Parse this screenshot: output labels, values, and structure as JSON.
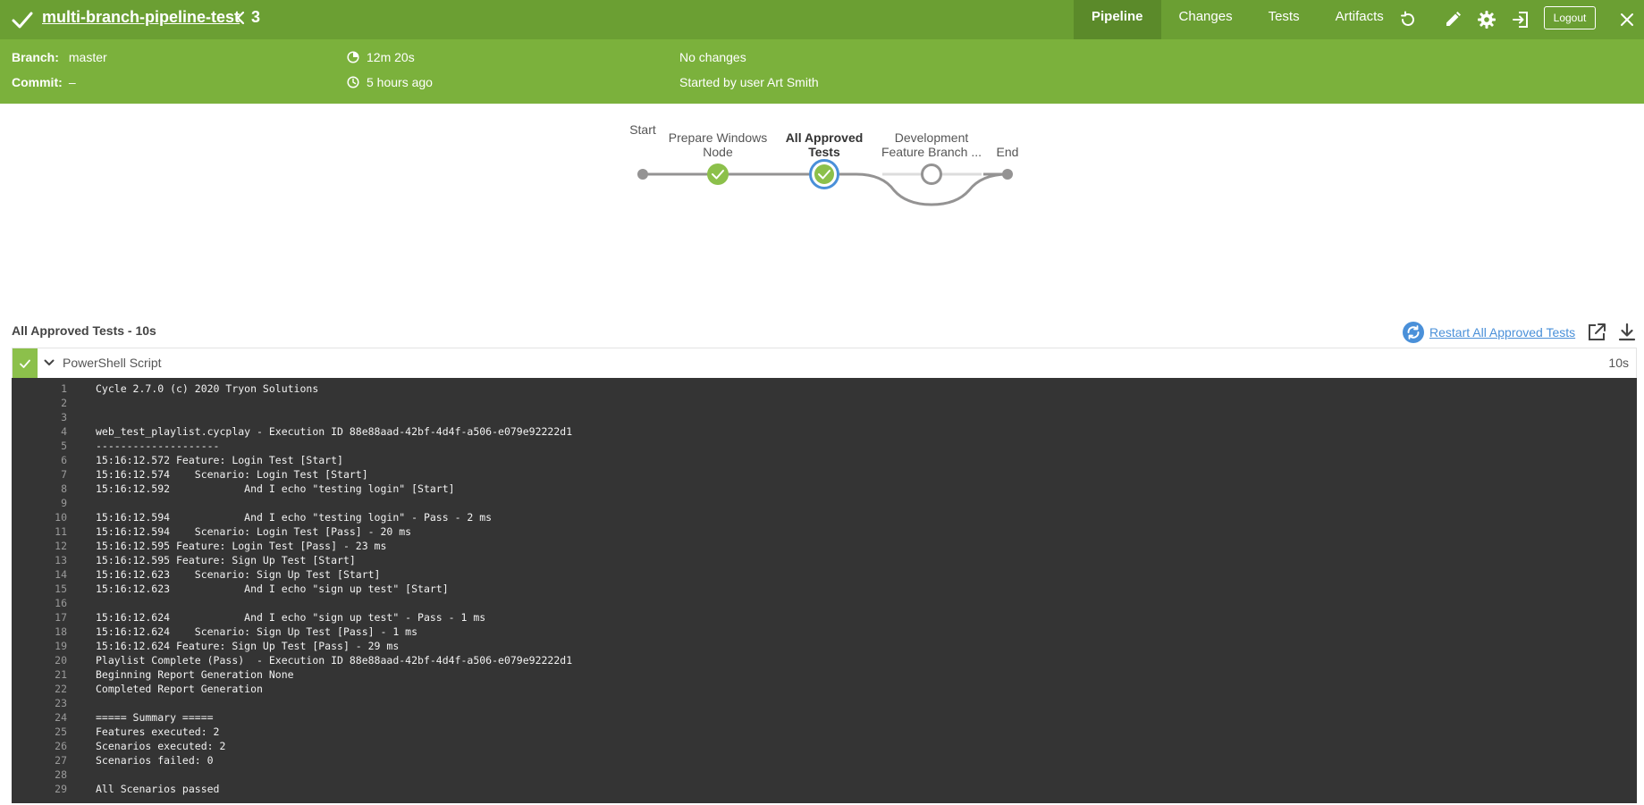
{
  "header": {
    "title": "multi-branch-pipeline-test",
    "run_number": "3",
    "tabs": [
      {
        "label": "Pipeline",
        "active": true
      },
      {
        "label": "Changes",
        "active": false
      },
      {
        "label": "Tests",
        "active": false
      },
      {
        "label": "Artifacts",
        "active": false
      }
    ],
    "logout_label": "Logout",
    "icons": [
      "check-icon",
      "chevron-left-icon",
      "replay-icon",
      "edit-pencil-icon",
      "settings-gear-icon",
      "exit-icon",
      "close-icon"
    ],
    "colors": {
      "header_bg": "#6b9f33",
      "info_bg": "#7bb13c",
      "success": "#8cc04b",
      "link": "#4a90d9"
    }
  },
  "info": {
    "branch_label": "Branch:",
    "branch_value": "master",
    "commit_label": "Commit:",
    "commit_value": "–",
    "duration": "12m 20s",
    "time_ago": "5 hours ago",
    "changes": "No changes",
    "started_by": "Started by user Art Smith"
  },
  "pipeline": {
    "stages": [
      {
        "line1": "Start",
        "line2": ""
      },
      {
        "line1": "Prepare Windows",
        "line2": "Node"
      },
      {
        "line1": "All Approved",
        "line2": "Tests"
      },
      {
        "line1": "Development",
        "line2": "Feature Branch ..."
      },
      {
        "line1": "End",
        "line2": ""
      }
    ]
  },
  "log": {
    "section_title": "All Approved Tests - 10s",
    "restart_label": "Restart All Approved Tests",
    "step_name": "PowerShell Script",
    "step_duration": "10s",
    "lines": [
      "Cycle 2.7.0 (c) 2020 Tryon Solutions",
      "",
      "",
      "web_test_playlist.cycplay - Execution ID 88e88aad-42bf-4d4f-a506-e079e92222d1",
      "--------------------",
      "15:16:12.572 Feature: Login Test [Start]",
      "15:16:12.574    Scenario: Login Test [Start]",
      "15:16:12.592            And I echo \"testing login\" [Start]",
      "",
      "15:16:12.594            And I echo \"testing login\" - Pass - 2 ms",
      "15:16:12.594    Scenario: Login Test [Pass] - 20 ms",
      "15:16:12.595 Feature: Login Test [Pass] - 23 ms",
      "15:16:12.595 Feature: Sign Up Test [Start]",
      "15:16:12.623    Scenario: Sign Up Test [Start]",
      "15:16:12.623            And I echo \"sign up test\" [Start]",
      "",
      "15:16:12.624            And I echo \"sign up test\" - Pass - 1 ms",
      "15:16:12.624    Scenario: Sign Up Test [Pass] - 1 ms",
      "15:16:12.624 Feature: Sign Up Test [Pass] - 29 ms",
      "Playlist Complete (Pass)  - Execution ID 88e88aad-42bf-4d4f-a506-e079e92222d1",
      "Beginning Report Generation None",
      "Completed Report Generation",
      "",
      "===== Summary =====",
      "Features executed: 2",
      "Scenarios executed: 2",
      "Scenarios failed: 0",
      "",
      "All Scenarios passed"
    ]
  }
}
